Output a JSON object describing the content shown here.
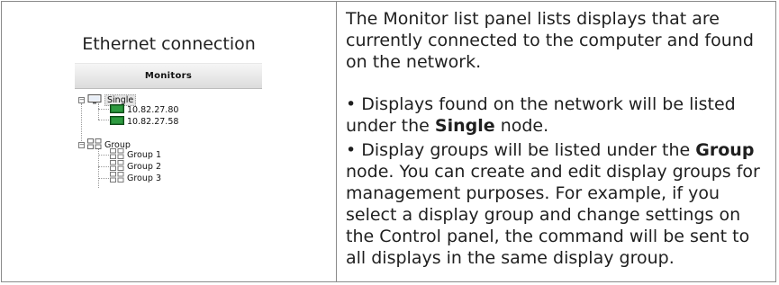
{
  "left": {
    "caption": "Ethernet connection",
    "panel": {
      "header": "Monitors",
      "tree": {
        "single": {
          "label": "Single",
          "children": [
            "10.82.27.80",
            "10.82.27.58"
          ]
        },
        "group": {
          "label": "Group",
          "children": [
            "Group 1",
            "Group 2",
            "Group 3"
          ]
        }
      },
      "expander_symbol": "−"
    }
  },
  "right": {
    "intro": "The Monitor list panel lists displays that are currently connected to the computer and found on the network.",
    "bullet1": {
      "bullet": "•",
      "before": "Displays found on the network will be listed under the",
      "bold": "Single",
      "after": "node."
    },
    "bullet2": {
      "bullet": "•",
      "before": "Display groups will be listed under the",
      "bold": "Group",
      "after": "node. You can create and edit display groups for management purposes. For example, if you select a display group and change settings on the Control panel, the command will be sent to all displays in the same display group."
    }
  },
  "colors": {
    "border": "#8a8a8a",
    "monitor_green": "#1f7a2e",
    "header_bg": "#dcdcdc"
  },
  "icons": {
    "single": "monitor-icon",
    "display": "display-green-icon",
    "group": "group-icon",
    "group_item": "group-item-icon",
    "expander": "collapse-icon"
  }
}
